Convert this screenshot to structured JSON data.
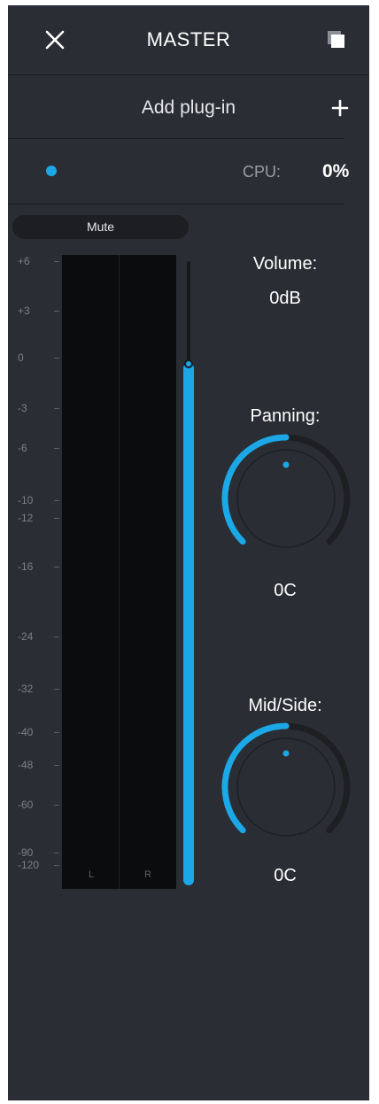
{
  "header": {
    "title": "MASTER",
    "close_icon": "close-icon",
    "window_icon": "window-icon"
  },
  "plugins": {
    "add_label": "Add plug-in",
    "add_icon": "plus-icon"
  },
  "status": {
    "indicator_color": "#1ca7e6",
    "cpu_label": "CPU:",
    "cpu_value": "0%"
  },
  "meter": {
    "mute_label": "Mute",
    "scale": [
      "+6",
      "+3",
      "0",
      "-3",
      "-6",
      "-10",
      "-12",
      "-16",
      "-24",
      "-32",
      "-40",
      "-48",
      "-60",
      "-90",
      "-120"
    ],
    "channels": [
      "L",
      "R"
    ],
    "fader_level_db": 0
  },
  "volume": {
    "label": "Volume:",
    "value": "0dB"
  },
  "panning": {
    "label": "Panning:",
    "value": "0C"
  },
  "mid_side": {
    "label": "Mid/Side:",
    "value": "0C"
  },
  "colors": {
    "accent": "#1ca7e6",
    "panel_bg": "#2a2d33",
    "meter_bg": "#0b0c0d"
  }
}
